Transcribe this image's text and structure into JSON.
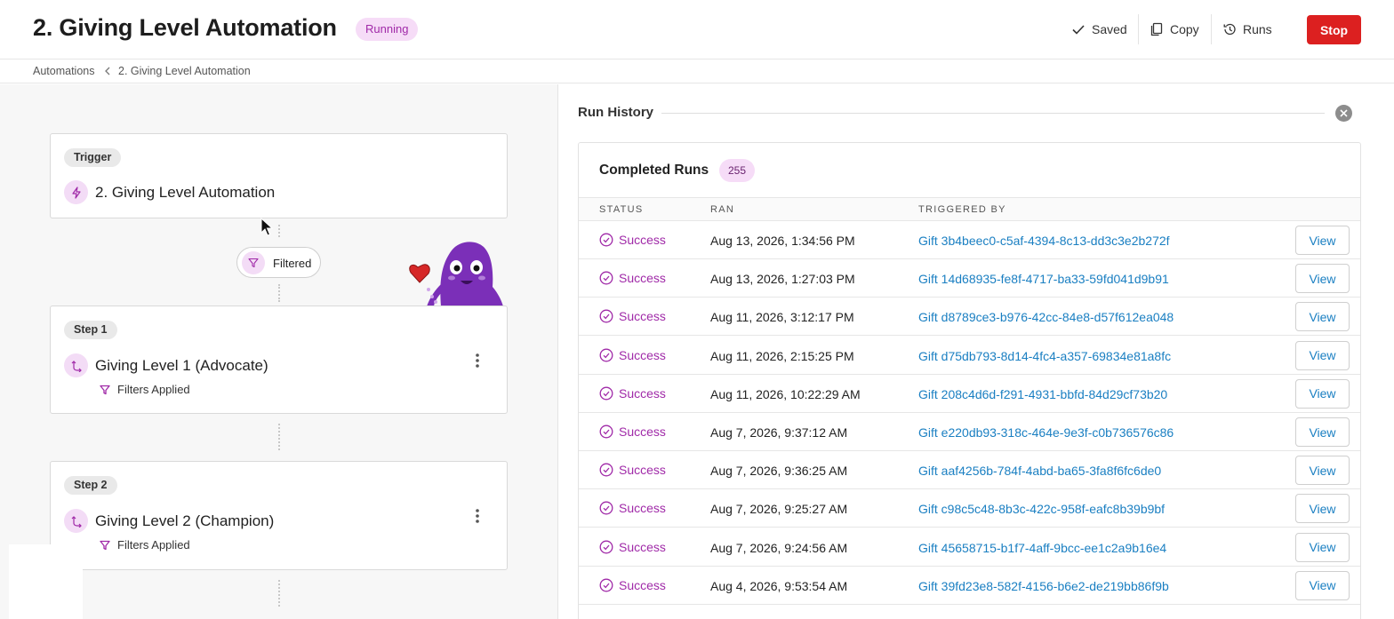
{
  "header": {
    "title": "2. Giving Level Automation",
    "status_badge": "Running",
    "actions": {
      "saved": "Saved",
      "copy": "Copy",
      "runs": "Runs",
      "stop": "Stop"
    }
  },
  "breadcrumb": [
    "Automations",
    "2. Giving Level Automation"
  ],
  "flow": {
    "trigger": {
      "chip": "Trigger",
      "title": "2. Giving Level Automation"
    },
    "filter_pill": "Filtered",
    "steps": [
      {
        "chip": "Step 1",
        "title": "Giving Level 1 (Advocate)",
        "note": "Filters Applied"
      },
      {
        "chip": "Step 2",
        "title": "Giving Level 2 (Champion)",
        "note": "Filters Applied"
      }
    ]
  },
  "run_history": {
    "title": "Run History",
    "completed_title": "Completed Runs",
    "completed_count": "255",
    "columns": [
      "STATUS",
      "RAN",
      "TRIGGERED BY"
    ],
    "view_label": "View",
    "rows": [
      {
        "status": "Success",
        "ran": "Aug 13, 2026, 1:34:56 PM",
        "triggered_by": "Gift 3b4beec0-c5af-4394-8c13-dd3c3e2b272f"
      },
      {
        "status": "Success",
        "ran": "Aug 13, 2026, 1:27:03 PM",
        "triggered_by": "Gift 14d68935-fe8f-4717-ba33-59fd041d9b91"
      },
      {
        "status": "Success",
        "ran": "Aug 11, 2026, 3:12:17 PM",
        "triggered_by": "Gift d8789ce3-b976-42cc-84e8-d57f612ea048"
      },
      {
        "status": "Success",
        "ran": "Aug 11, 2026, 2:15:25 PM",
        "triggered_by": "Gift d75db793-8d14-4fc4-a357-69834e81a8fc"
      },
      {
        "status": "Success",
        "ran": "Aug 11, 2026, 10:22:29 AM",
        "triggered_by": "Gift 208c4d6d-f291-4931-bbfd-84d29cf73b20"
      },
      {
        "status": "Success",
        "ran": "Aug 7, 2026, 9:37:12 AM",
        "triggered_by": "Gift e220db93-318c-464e-9e3f-c0b736576c86"
      },
      {
        "status": "Success",
        "ran": "Aug 7, 2026, 9:36:25 AM",
        "triggered_by": "Gift aaf4256b-784f-4abd-ba65-3fa8f6fc6de0"
      },
      {
        "status": "Success",
        "ran": "Aug 7, 2026, 9:25:27 AM",
        "triggered_by": "Gift c98c5c48-8b3c-422c-958f-eafc8b39b9bf"
      },
      {
        "status": "Success",
        "ran": "Aug 7, 2026, 9:24:56 AM",
        "triggered_by": "Gift 45658715-b1f7-4aff-9bcc-ee1c2a9b16e4"
      },
      {
        "status": "Success",
        "ran": "Aug 4, 2026, 9:53:54 AM",
        "triggered_by": "Gift 39fd23e8-582f-4156-b6e2-de219bb86f9b"
      }
    ]
  },
  "colors": {
    "accent": "#a02aa8",
    "stop": "#dc2020",
    "link": "#1a7fc2",
    "badge_bg": "#f6dcf7"
  }
}
